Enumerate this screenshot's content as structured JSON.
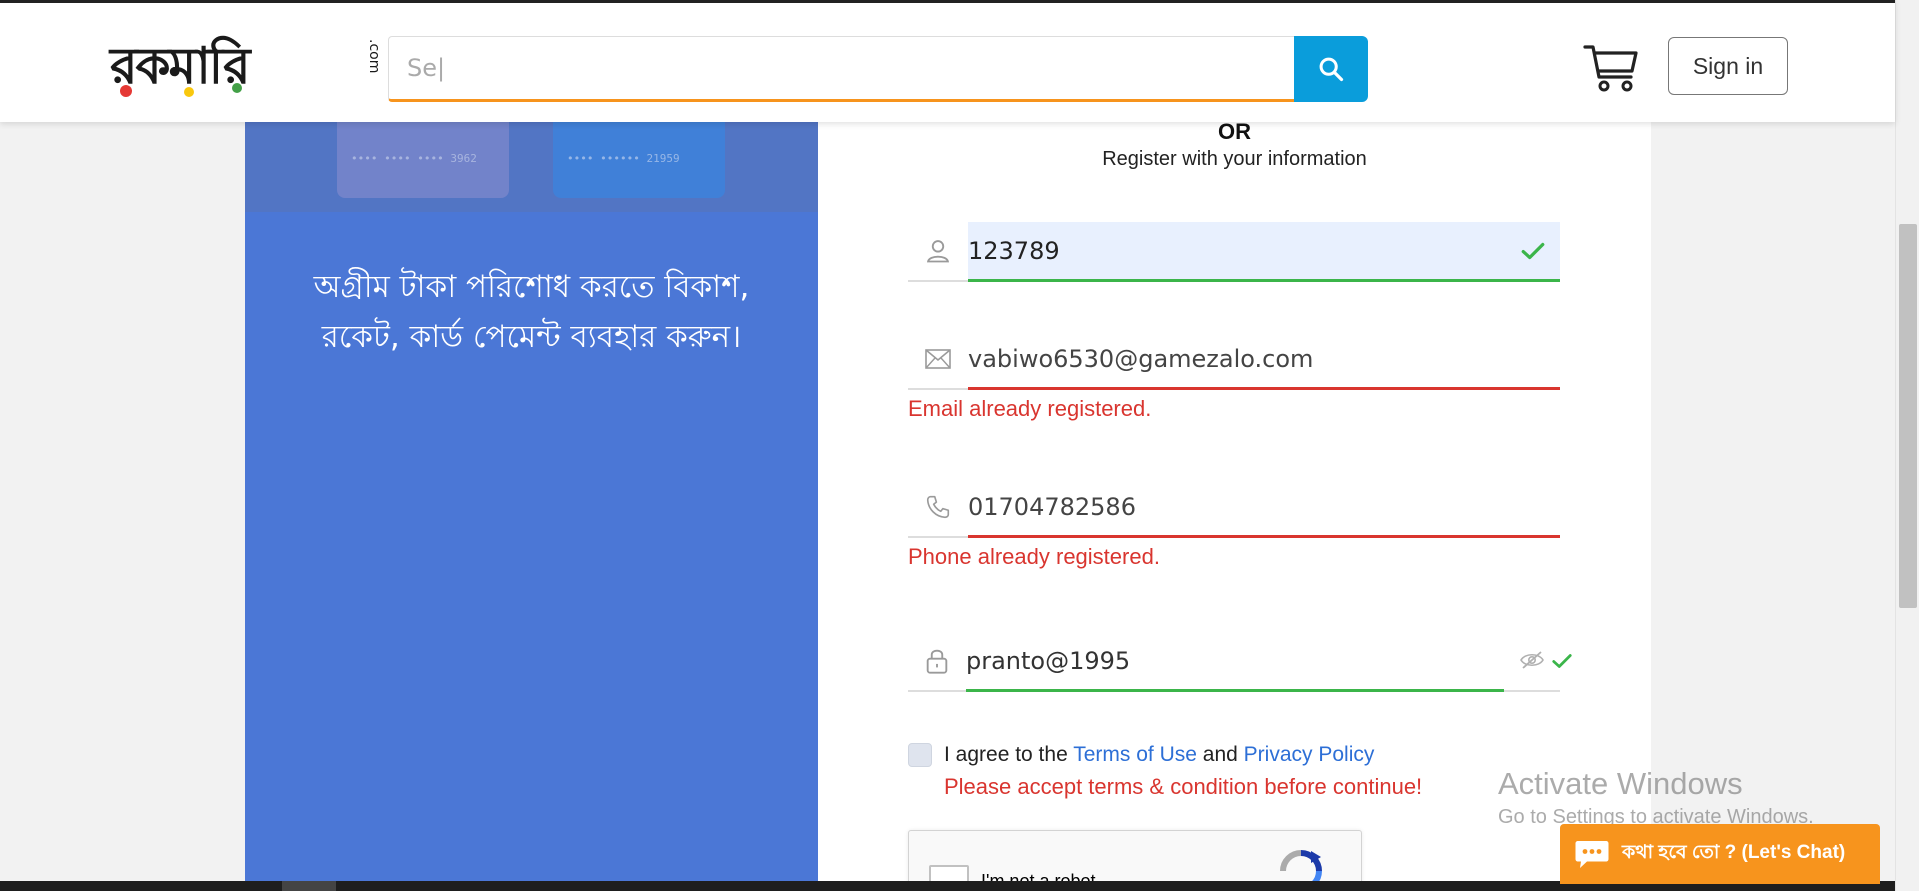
{
  "header": {
    "logo_text": "রকমারি",
    "logo_suffix": ".com",
    "search_placeholder": "Se|",
    "signin_label": "Sign in"
  },
  "left_panel": {
    "card1_digits": "•••• •••• •••• 3962",
    "card2_digits": "•••• •••••• 21959",
    "message": "অগ্রীম টাকা পরিশোধ করতে বিকাশ, রকেট, কার্ড পেমেন্ট ব্যবহার করুন।"
  },
  "form": {
    "or_label": "OR",
    "register_subtitle": "Register with your information",
    "name_value": "123789",
    "email_value": "vabiwo6530@gamezalo.com",
    "email_error": "Email already registered.",
    "phone_value": "01704782586",
    "phone_error": "Phone already registered.",
    "password_value": "pranto@1995",
    "terms_prefix": "I agree to the",
    "terms_link": "Terms of Use",
    "terms_and": "and",
    "privacy_link": "Privacy Policy",
    "terms_error": "Please accept terms & condition before continue!",
    "captcha_label": "I'm not a robot"
  },
  "watermark": {
    "line1": "Activate Windows",
    "line2": "Go to Settings to activate Windows."
  },
  "chat": {
    "label": "কথা হবে তো ? (Let's Chat)"
  },
  "colors": {
    "primary_blue": "#4b77d6",
    "search_button": "#0a9ddb",
    "accent_orange": "#f7941d",
    "error_red": "#d9352f",
    "success_green": "#3bb54a",
    "link_blue": "#2d6fd6"
  },
  "icons": [
    "search-icon",
    "cart-icon",
    "user-icon",
    "envelope-icon",
    "phone-icon",
    "lock-icon",
    "eye-slash-icon",
    "checkmark-icon",
    "recaptcha-icon",
    "chat-bubble-icon"
  ]
}
